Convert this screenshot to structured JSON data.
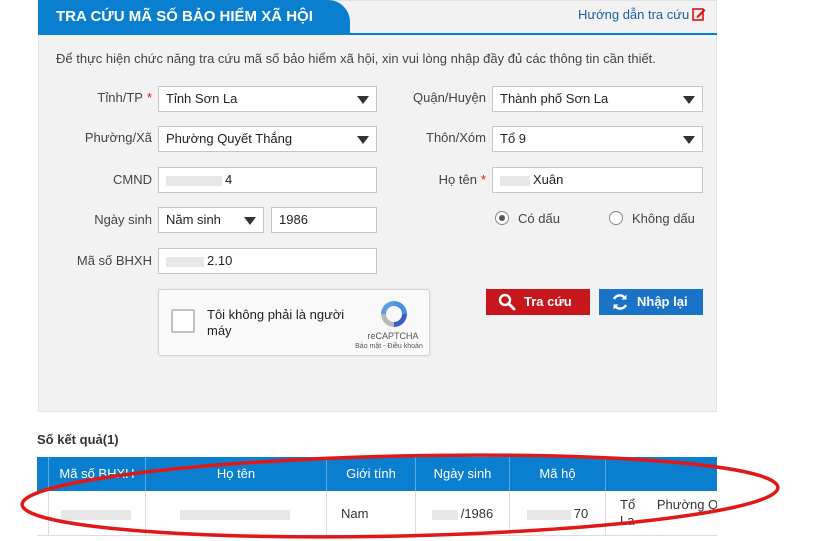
{
  "header": {
    "title": "TRA CỨU MÃ SỐ BẢO HIỂM XÃ HỘI",
    "guide_link": "Hướng dẫn tra cứu",
    "guide_icon": "edit-icon"
  },
  "intro": "Để thực hiện chức năng tra cứu mã số bảo hiểm xã hội, xin vui lòng nhập đầy đủ các thông tin cần thiết.",
  "form": {
    "province": {
      "label": "Tỉnh/TP",
      "required": "*",
      "value": "Tỉnh Sơn La"
    },
    "district": {
      "label": "Quận/Huyện",
      "value": "Thành phố Sơn La"
    },
    "ward": {
      "label": "Phường/Xã",
      "value": "Phường Quyết Thắng"
    },
    "hamlet": {
      "label": "Thôn/Xóm",
      "value": "Tổ 9"
    },
    "id_card": {
      "label": "CMND",
      "visible_value": "4"
    },
    "full_name": {
      "label": "Họ tên",
      "required": "*",
      "visible_value": "Xuân"
    },
    "dob": {
      "label": "Ngày sinh",
      "type_value": "Năm sinh",
      "year_value": "1986"
    },
    "accent": {
      "with_accent": "Có dấu",
      "without_accent": "Không dấu",
      "selected": "with_accent"
    },
    "bhxh": {
      "label": "Mã số BHXH",
      "visible_value": "2.10"
    }
  },
  "captcha": {
    "text": "Tôi không phải là người máy",
    "brand": "reCAPTCHA",
    "terms": "Bảo mật - Điều khoản"
  },
  "buttons": {
    "search": "Tra cứu",
    "reset": "Nhập lại"
  },
  "results": {
    "count_label": "Số kết quả(1)",
    "columns": [
      "Mã số BHXH",
      "Họ tên",
      "Giới tính",
      "Ngày sinh",
      "Mã hộ"
    ],
    "row": {
      "bhxh": "",
      "name": "",
      "gender": "Nam",
      "dob": "/1986",
      "household": "70",
      "address_line1": "Tổ",
      "address_line1b": "Phường Qu",
      "address_line2": "La"
    }
  },
  "colors": {
    "primary_blue": "#0a7fd0",
    "search_red": "#c8161d",
    "reset_blue": "#1a73c7",
    "annotation_red": "#e01818"
  }
}
